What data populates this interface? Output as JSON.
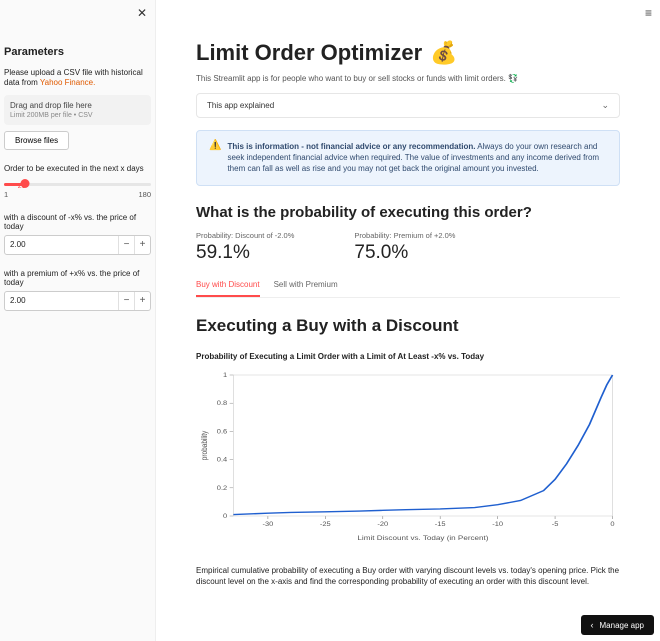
{
  "hamburger_title": "Menu",
  "header": {
    "title": "Limit Order Optimizer",
    "emoji": "💰",
    "subtitle": "This Streamlit app is for people who want to buy or sell stocks or funds with limit orders. 💱"
  },
  "sidebar": {
    "heading": "Parameters",
    "upload_prefix": "Please upload a CSV file with historical data from ",
    "upload_link": "Yahoo Finance.",
    "dropzone_main": "Drag and drop file here",
    "dropzone_sub": "Limit 200MB per file • CSV",
    "browse": "Browse files",
    "slider_label": "Order to be executed in the next x days",
    "slider_value": "20",
    "slider_min": "1",
    "slider_max": "180",
    "discount_label": "with a discount of -x% vs. the price of today",
    "discount_value": "2.00",
    "premium_label": "with a premium of +x% vs. the price of today",
    "premium_value": "2.00"
  },
  "expander": {
    "label": "This app explained"
  },
  "infobox": {
    "bold": "This is information - not financial advice or any recommendation.",
    "rest": " Always do your own research and seek independent financial advice when required. The value of investments and any income derived from them can fall as well as rise and you may not get back the original amount you invested."
  },
  "prob_section_title": "What is the probability of executing this order?",
  "metrics": {
    "discount_label": "Probability: Discount of -2.0%",
    "discount_value": "59.1%",
    "premium_label": "Probability: Premium of +2.0%",
    "premium_value": "75.0%"
  },
  "tabs": {
    "buy": "Buy with Discount",
    "sell": "Sell with Premium"
  },
  "exec_title": "Executing a Buy with a Discount",
  "chart_title": "Probability of Executing a Limit Order with a Limit of At Least -x% vs. Today",
  "xlabel": "Limit Discount vs. Today (in Percent)",
  "ylabel": "probability",
  "empirical_text": "Empirical cumulative probability of executing a Buy order with varying discount levels vs. today's opening price. Pick the discount level on the x-axis and find the corresponding probability of executing an order with this discount level.",
  "manage_app": "Manage app",
  "chart_data": {
    "type": "line",
    "xlabel": "Limit Discount vs. Today (in Percent)",
    "ylabel": "probability",
    "xlim": [
      -33,
      0
    ],
    "ylim": [
      0,
      1
    ],
    "yticks": [
      0,
      0.2,
      0.4,
      0.6,
      0.8,
      1
    ],
    "xticks": [
      -30,
      -25,
      -20,
      -15,
      -10,
      -5,
      0
    ],
    "title": "Probability of Executing a Limit Order with a Limit of At Least -x% vs. Today",
    "series": [
      {
        "name": "probability",
        "color": "#1f5fcf",
        "x": [
          -33,
          -30,
          -28,
          -25,
          -22,
          -20,
          -18,
          -15,
          -12,
          -10,
          -8,
          -6,
          -5,
          -4,
          -3,
          -2,
          -1,
          -0.5,
          0
        ],
        "values": [
          0.01,
          0.02,
          0.025,
          0.03,
          0.035,
          0.04,
          0.045,
          0.05,
          0.06,
          0.08,
          0.11,
          0.18,
          0.26,
          0.37,
          0.5,
          0.65,
          0.84,
          0.93,
          1.0
        ]
      }
    ]
  }
}
